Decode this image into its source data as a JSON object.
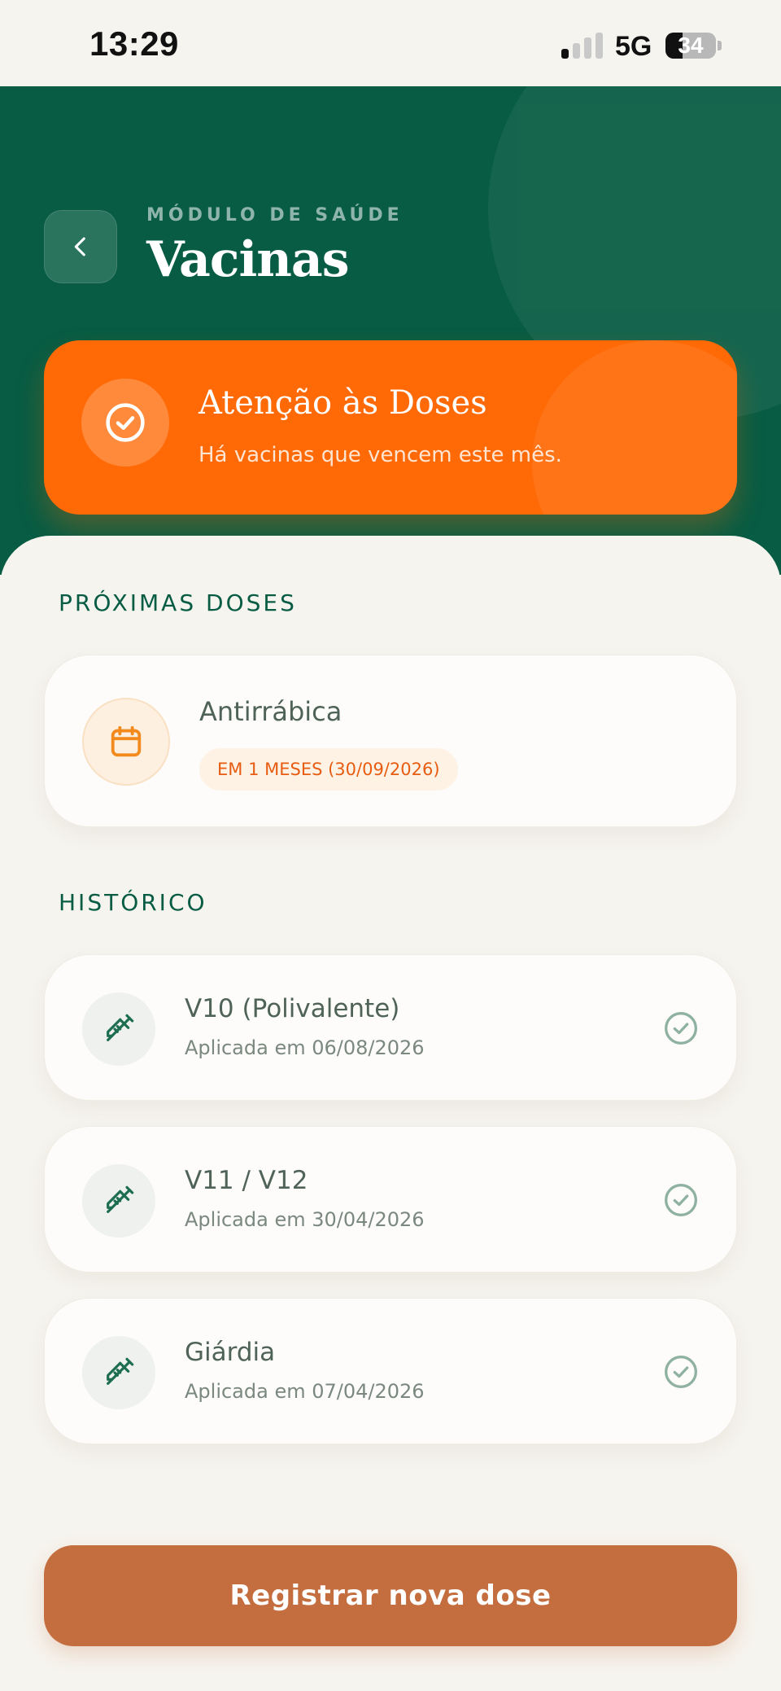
{
  "status_bar": {
    "time": "13:29",
    "network": "5G",
    "battery_percent": "34",
    "battery_level": 0.34,
    "signal_bars_active": 1,
    "signal_bars_total": 4
  },
  "header": {
    "module_label": "MÓDULO DE SAÚDE",
    "title": "Vacinas",
    "back_icon": "chevron-left-icon",
    "background_color": "#075c43"
  },
  "alert": {
    "title": "Atenção às Doses",
    "subtitle": "Há vacinas que vencem este mês.",
    "icon": "check-circle-icon",
    "color": "#ff6a06"
  },
  "upcoming": {
    "heading": "PRÓXIMAS DOSES",
    "items": [
      {
        "name": "Antirrábica",
        "badge": "EM 1 MESES (30/09/2026)",
        "icon": "calendar-icon"
      }
    ]
  },
  "history": {
    "heading": "HISTÓRICO",
    "items": [
      {
        "name": "V10 (Polivalente)",
        "date": "Aplicada em 06/08/2026",
        "icon": "syringe-icon",
        "status_icon": "check-circle-icon"
      },
      {
        "name": "V11 / V12",
        "date": "Aplicada em 30/04/2026",
        "icon": "syringe-icon",
        "status_icon": "check-circle-icon"
      },
      {
        "name": "Giárdia",
        "date": "Aplicada em 07/04/2026",
        "icon": "syringe-icon",
        "status_icon": "check-circle-icon"
      }
    ]
  },
  "actions": {
    "register_label": "Registrar nova dose",
    "button_color": "#c46e3f"
  }
}
